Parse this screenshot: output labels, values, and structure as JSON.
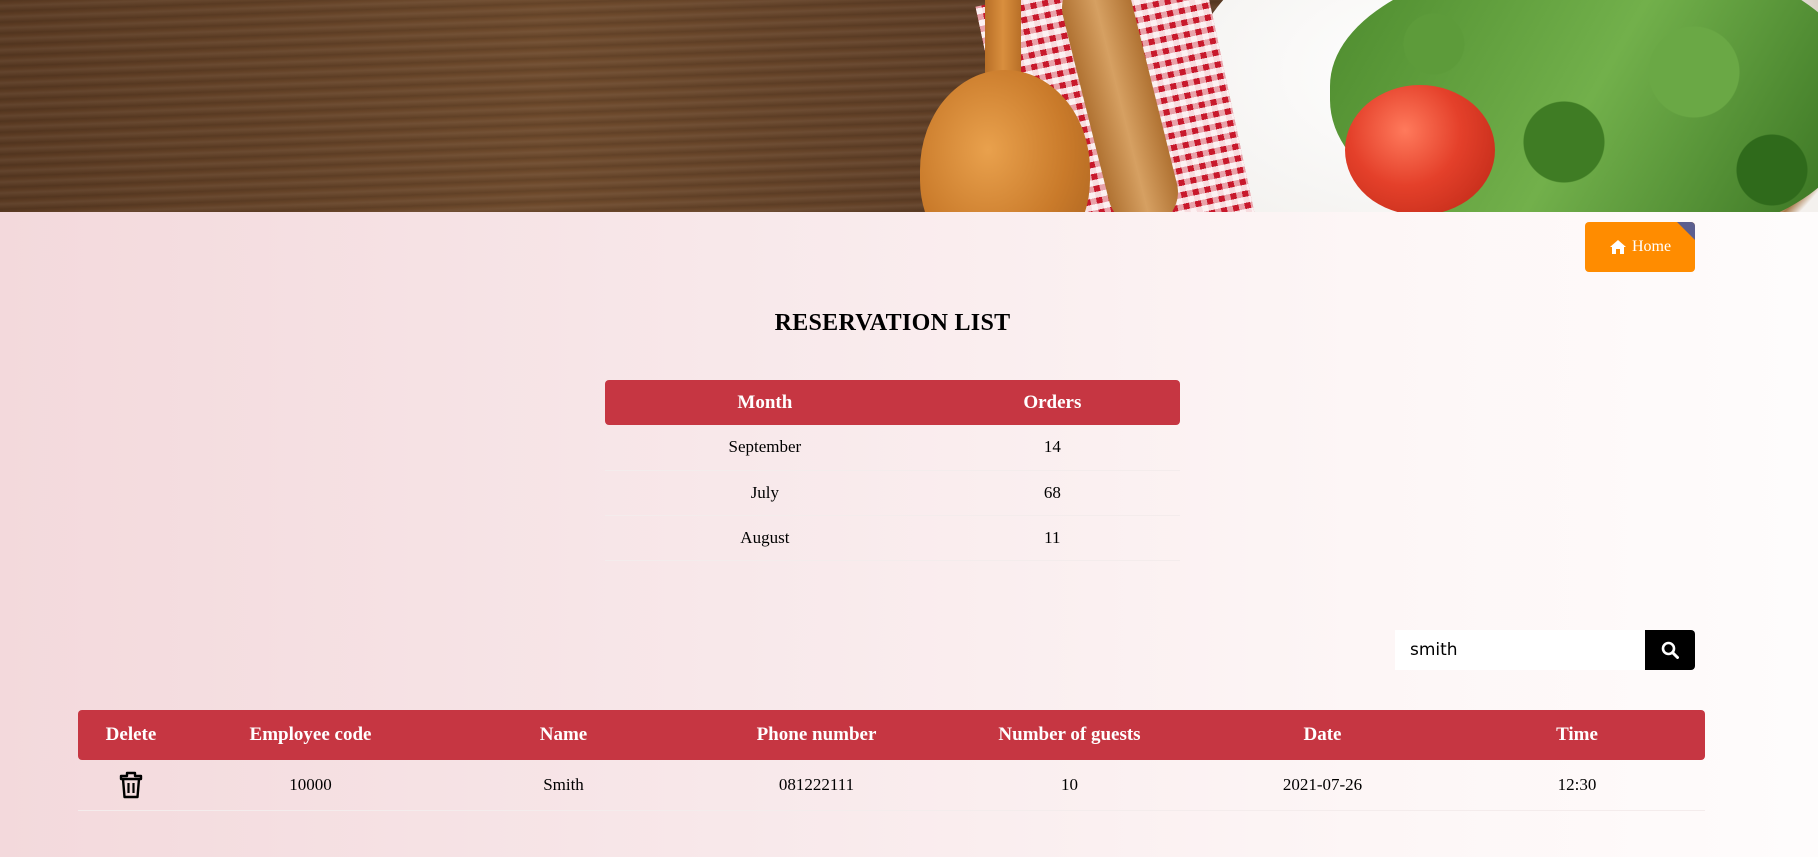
{
  "nav": {
    "home_label": "Home"
  },
  "page_title": "RESERVATION LIST",
  "summary_table": {
    "headers": [
      "Month",
      "Orders"
    ],
    "rows": [
      [
        "September",
        "14"
      ],
      [
        "July",
        "68"
      ],
      [
        "August",
        "11"
      ]
    ]
  },
  "search": {
    "value": "smith",
    "placeholder": ""
  },
  "reservations_table": {
    "headers": [
      "Delete",
      "Employee code",
      "Name",
      "Phone number",
      "Number of guests",
      "Date",
      "Time"
    ],
    "rows": [
      {
        "employee_code": "10000",
        "name": "Smith",
        "phone": "081222111",
        "guests": "10",
        "date": "2021-07-26",
        "time": "12:30"
      }
    ]
  },
  "colors": {
    "header_red": "#c63642",
    "home_orange": "#ff8c00",
    "search_button": "#000000"
  },
  "icons": {
    "home": "home-icon",
    "search": "search-icon",
    "delete": "trash-icon"
  }
}
